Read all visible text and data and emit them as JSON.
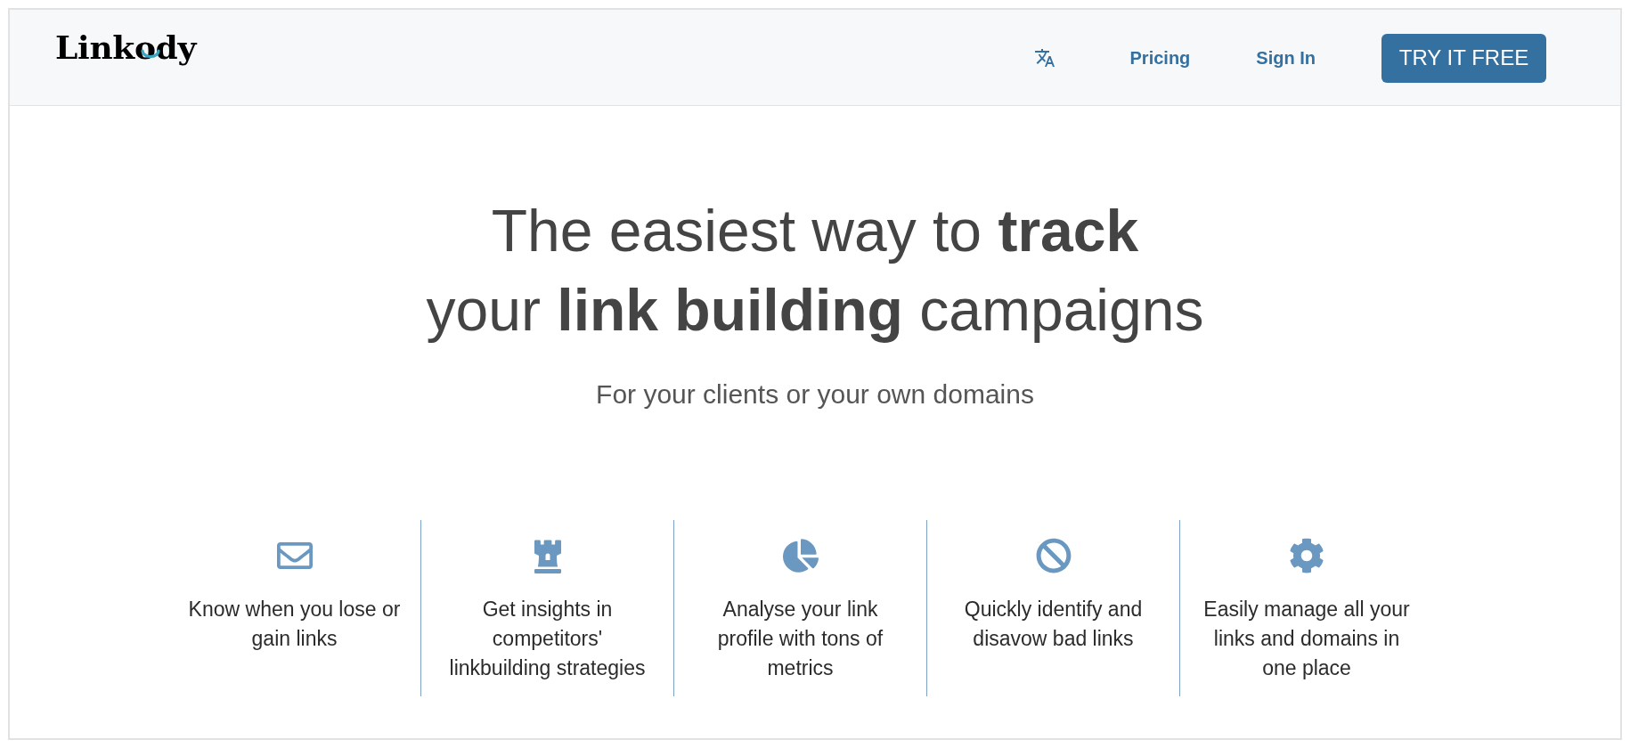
{
  "logo": {
    "text": "Linkody"
  },
  "nav": {
    "links": [
      {
        "label": "Pricing"
      },
      {
        "label": "Sign In"
      }
    ],
    "cta": "TRY IT FREE"
  },
  "hero": {
    "headline": [
      "The easiest way to **track**",
      "your **link building** campaigns"
    ],
    "subtitle": "For your clients or your own domains"
  },
  "features": [
    {
      "kind": "envelope",
      "text": "Know when you lose or gain links"
    },
    {
      "kind": "rook",
      "text": "Get insights in competitors' linkbuilding strategies"
    },
    {
      "kind": "pie",
      "text": "Analyse your link profile with tons of metrics"
    },
    {
      "kind": "ban",
      "text": "Quickly identify and disavow bad links"
    },
    {
      "kind": "gear",
      "text": "Easily manage all your links and domains in one place"
    }
  ]
}
